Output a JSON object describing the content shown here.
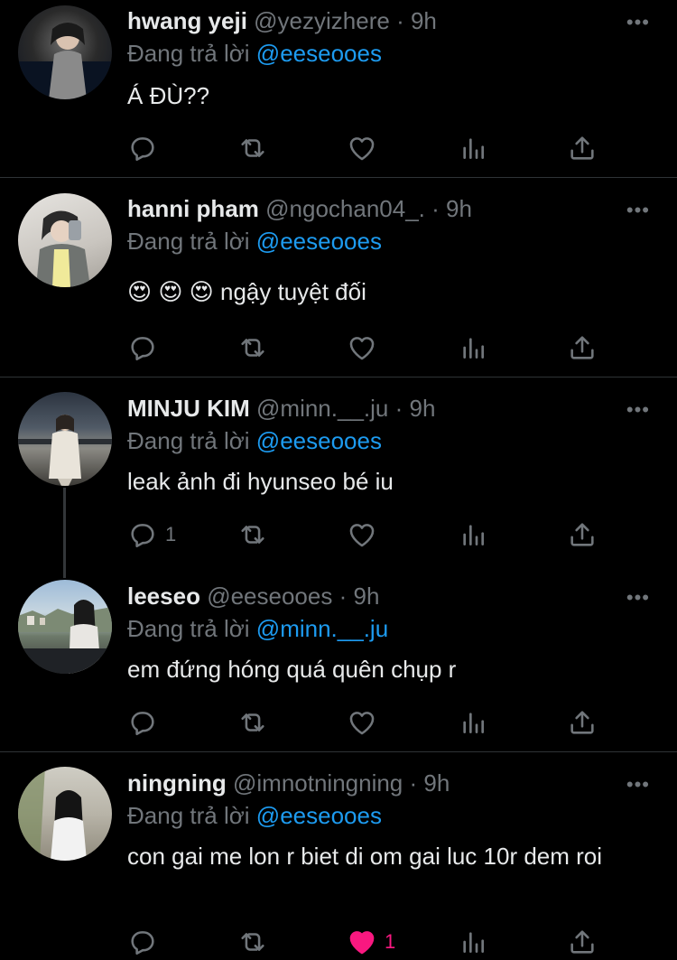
{
  "replying_label": "Đang trả lời",
  "colors": {
    "background": "#000000",
    "text": "#e7e9ea",
    "muted": "#71767b",
    "mention": "#1d9bf0",
    "like": "#f91880"
  },
  "more_label": "•••",
  "tweets": [
    {
      "name": "hwang yeji",
      "handle": "@yezyizhere",
      "dot": "·",
      "time": "9h",
      "replying_to": "@eeseooes",
      "text": "Á ĐÙ??",
      "reply_count": "",
      "like_count": "",
      "liked": false
    },
    {
      "name": "hanni pham",
      "handle": "@ngochan04_.",
      "dot": "·",
      "time": "9h",
      "replying_to": "@eeseooes",
      "text": "😍 😍 😍 ngậy tuyệt đối",
      "reply_count": "",
      "like_count": "",
      "liked": false
    },
    {
      "name": "MINJU KIM",
      "handle": "@minn.__.ju",
      "dot": "·",
      "time": "9h",
      "replying_to": "@eeseooes",
      "text": "leak ảnh đi hyunseo bé iu",
      "reply_count": "1",
      "like_count": "",
      "liked": false
    },
    {
      "name": "leeseo",
      "handle": "@eeseooes",
      "dot": "·",
      "time": "9h",
      "replying_to": "@minn.__.ju",
      "text": "em đứng hóng quá quên chụp r",
      "reply_count": "",
      "like_count": "",
      "liked": false
    },
    {
      "name": "ningning",
      "handle": "@imnotningning",
      "dot": "·",
      "time": "9h",
      "replying_to": "@eeseooes",
      "text": "con gai me lon r biet di om gai luc 10r dem roi",
      "reply_count": "",
      "like_count": "1",
      "liked": true
    }
  ]
}
